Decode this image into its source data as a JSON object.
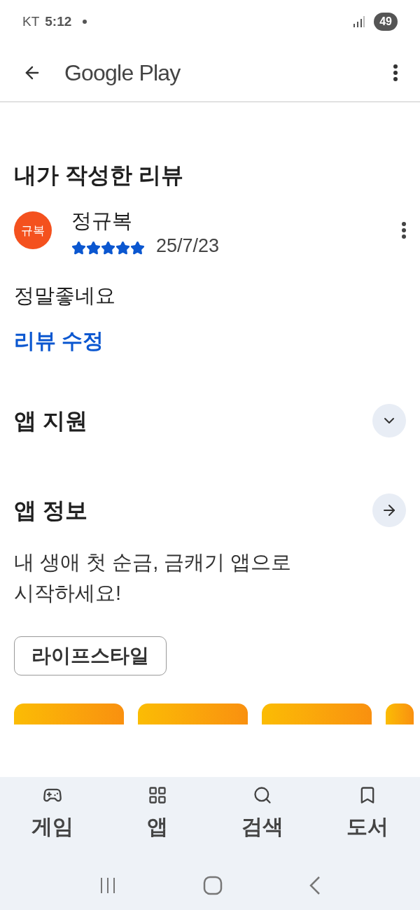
{
  "status_bar": {
    "carrier": "KT",
    "time": "5:12",
    "battery": "49"
  },
  "app_bar": {
    "title": "Google Play"
  },
  "my_review": {
    "heading": "내가 작성한 리뷰",
    "avatar": "규복",
    "author": "정규복",
    "stars": 5,
    "date": "25/7/23",
    "text": "정말좋네요",
    "edit_link": "리뷰 수정"
  },
  "app_support": {
    "heading": "앱 지원",
    "expanded": false
  },
  "app_info": {
    "heading": "앱 정보",
    "description": "내 생애 첫 순금, 금캐기 앱으로 시작하세요!",
    "tag": "라이프스타일"
  },
  "bottom_nav": [
    {
      "label": "게임",
      "kind": "games",
      "selected": false
    },
    {
      "label": "앱",
      "kind": "apps",
      "selected": false
    },
    {
      "label": "검색",
      "kind": "search",
      "selected": false
    },
    {
      "label": "도서",
      "kind": "books",
      "selected": false
    }
  ]
}
